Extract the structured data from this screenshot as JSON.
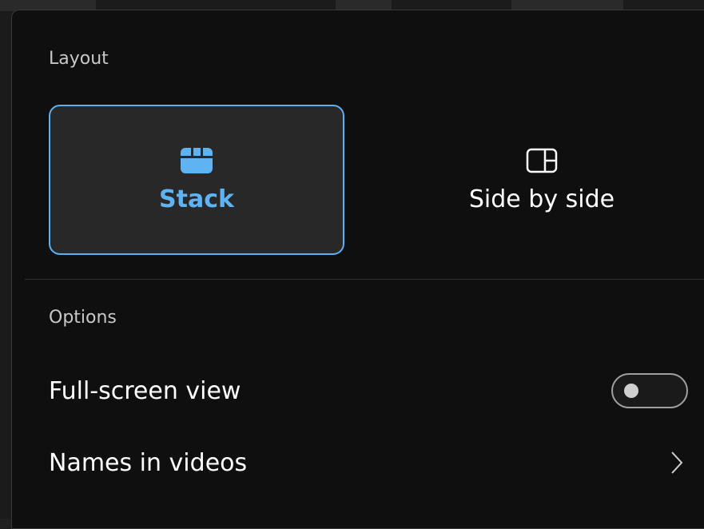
{
  "layout": {
    "title": "Layout",
    "options": [
      {
        "label": "Stack",
        "icon": "stack-layout-icon",
        "selected": true
      },
      {
        "label": "Side by side",
        "icon": "side-by-side-layout-icon",
        "selected": false
      }
    ]
  },
  "options": {
    "title": "Options",
    "full_screen": {
      "label": "Full-screen view",
      "enabled": false
    },
    "names_in_videos": {
      "label": "Names in videos",
      "icon": "chevron-right-icon"
    }
  },
  "colors": {
    "accent": "#5fb3f2",
    "panel_background": "#0f0f0f",
    "selected_card": "#282828"
  }
}
